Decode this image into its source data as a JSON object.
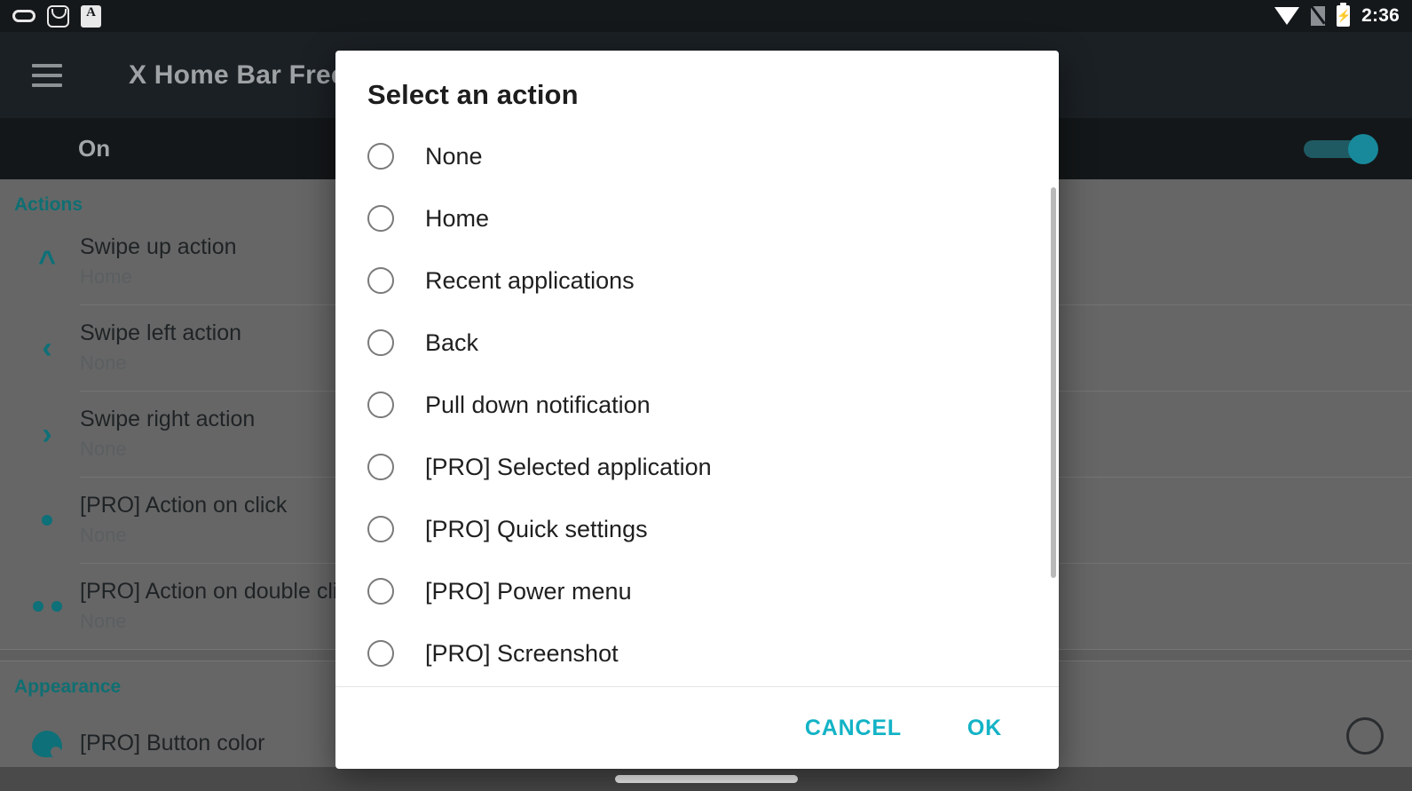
{
  "statusbar": {
    "left_icons": [
      "pill-icon",
      "inbox-icon",
      "a-badge-icon"
    ],
    "a_badge_text": "A",
    "right_icons": [
      "wifi-icon",
      "sim-off-icon",
      "battery-charging-icon"
    ],
    "time": "2:36"
  },
  "appbar": {
    "menu_icon": "hamburger-menu-icon",
    "title": "X Home Bar Free"
  },
  "master_switch": {
    "label": "On",
    "state": "on",
    "accent_color": "#17899b"
  },
  "settings": {
    "sections": [
      {
        "heading": "Actions",
        "items": [
          {
            "icon": "chevron-up-icon",
            "glyph": "⌃",
            "title": "Swipe up action",
            "value": "Home"
          },
          {
            "icon": "chevron-left-icon",
            "glyph": "‹",
            "title": "Swipe left action",
            "value": "None"
          },
          {
            "icon": "chevron-right-icon",
            "glyph": "›",
            "title": "Swipe right action",
            "value": "None"
          },
          {
            "icon": "single-dot-icon",
            "glyph": "",
            "title": "[PRO] Action on click",
            "value": "None"
          },
          {
            "icon": "double-dot-icon",
            "glyph": "",
            "title": "[PRO] Action on double click",
            "value": "None"
          }
        ]
      },
      {
        "heading": "Appearance",
        "items": [
          {
            "icon": "palette-icon",
            "glyph": "",
            "title": "[PRO] Button color",
            "value": ""
          }
        ]
      }
    ],
    "section_accent_color": "#0f6f73"
  },
  "dialog": {
    "title": "Select an action",
    "selected_index": -1,
    "options": [
      "None",
      "Home",
      "Recent applications",
      "Back",
      "Pull down notification",
      "[PRO] Selected application",
      "[PRO] Quick settings",
      "[PRO] Power menu",
      "[PRO] Screenshot"
    ],
    "buttons": {
      "cancel": "CANCEL",
      "ok": "OK",
      "color": "#13b3c6"
    },
    "scrollbar": {
      "visible": true
    }
  },
  "navbar": {
    "gesture_pill": "home-gesture-pill"
  }
}
